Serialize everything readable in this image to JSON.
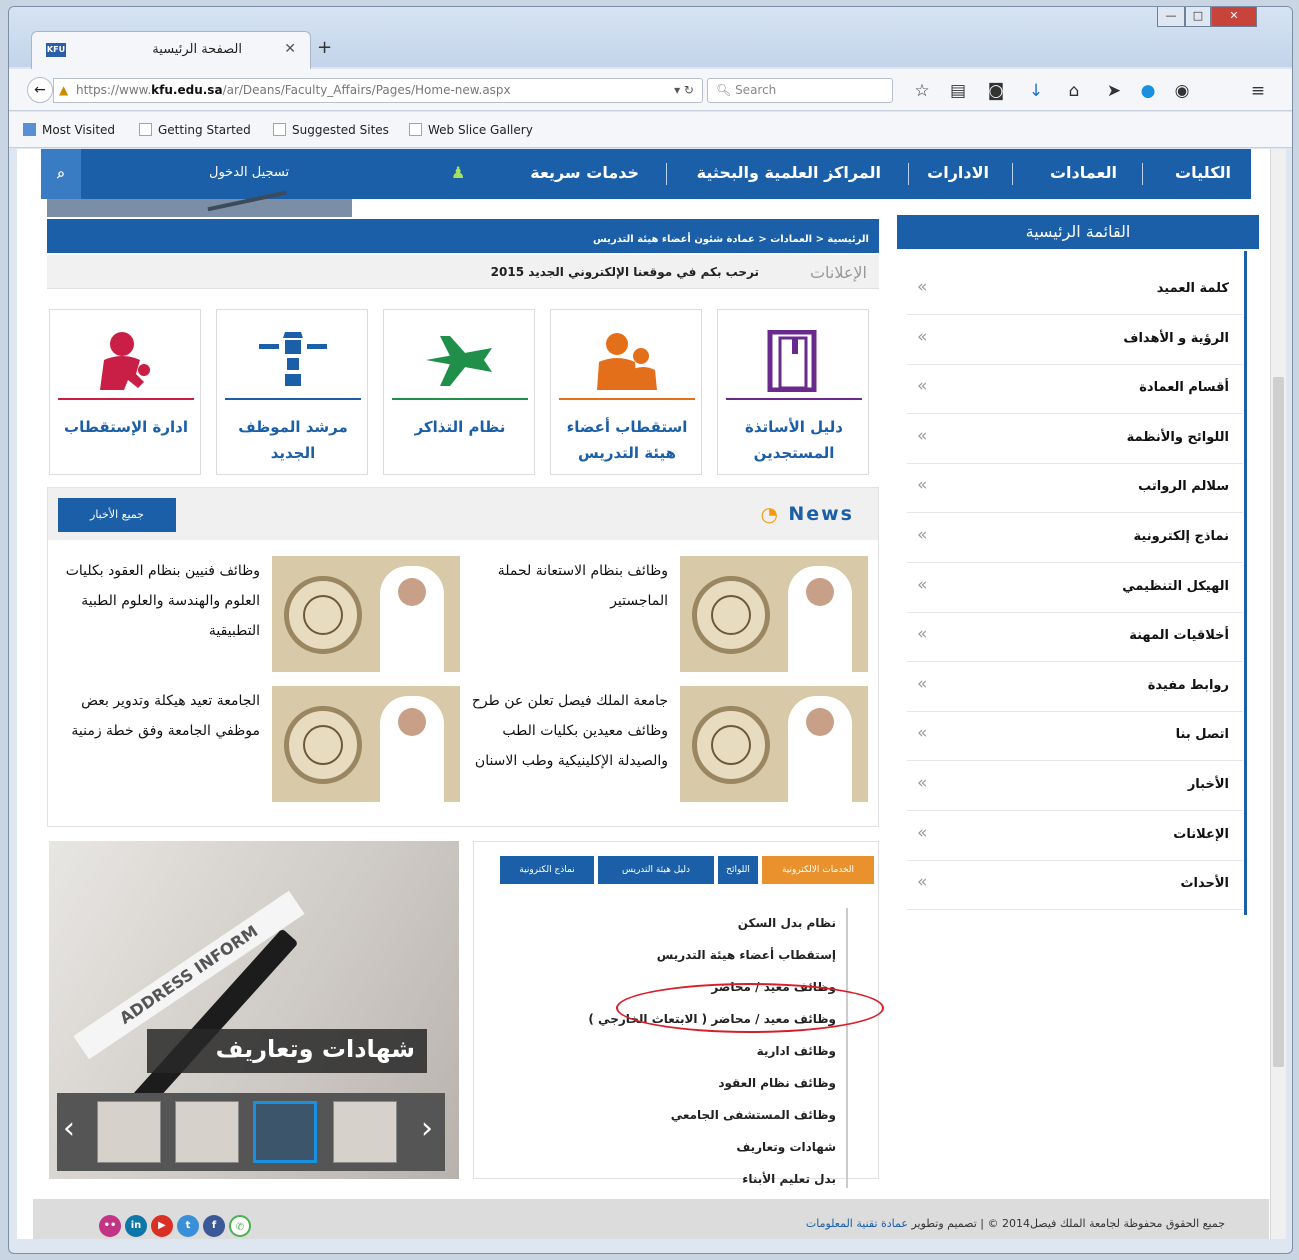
{
  "browser": {
    "tab_title": "الصفحة الرئيسية",
    "tab_favicon": "KFU",
    "url_domain": "kfu.edu.sa",
    "url_prefix": "https://www.",
    "url_path": "/ar/Deans/Faculty_Affairs/Pages/Home-new.aspx",
    "search_placeholder": "Search",
    "bookmarks": [
      "Most Visited",
      "Getting Started",
      "Suggested Sites",
      "Web Slice Gallery"
    ]
  },
  "topnav": {
    "items": [
      "الكليات",
      "العمادات",
      "الادارات",
      "المراكز العلمية والبحثية",
      "خدمات سريعة"
    ],
    "login": "تسجيل الدخول"
  },
  "breadcrumb": "الرئيسية  <  العمادات  <  عمادة شئون أعضاء هيئة التدريس",
  "ticker": {
    "label": "الإعلانات",
    "message": "ترحب بكم في موقعنا الإلكتروني الجديد 2015"
  },
  "tiles": [
    {
      "label": "دليل الأساتذة المستجدين",
      "color": "#6a2a8c",
      "icon": "book-icon"
    },
    {
      "label": "استقطاب أعضاء هيئة التدريس",
      "color": "#e46f1b",
      "icon": "people-icon"
    },
    {
      "label": "نظام التذاكر",
      "color": "#1f8f4a",
      "icon": "plane-icon"
    },
    {
      "label": "مرشد الموظف الجديد",
      "color": "#1b5fa8",
      "icon": "lighthouse-icon"
    },
    {
      "label": "ادارة الإستقطاب",
      "color": "#c91f47",
      "icon": "person-key-icon"
    }
  ],
  "news": {
    "title": "News",
    "all_button": "جميع الأخبار",
    "items": [
      "وظائف بنظام الاستعانة لحملة الماجستير",
      "وظائف فنيين بنظام العقود بكليات العلوم والهندسة والعلوم الطبية التطبيقية",
      "جامعة الملك فيصل تعلن عن طرح وظائف معيدين بكليات الطب والصيدلة الإكلينيكية وطب الاسنان",
      "الجامعة تعيد هيكلة وتدوير بعض موظفي الجامعة وفق خطة زمنية"
    ]
  },
  "promo": {
    "caption": "شهادات وتعاريف",
    "stamp": "ADDRESS INFORM"
  },
  "eservices": {
    "tabs": [
      {
        "label": "الخدمات الالكترونية",
        "color": "#e8912d"
      },
      {
        "label": "اللوائح",
        "color": "#1b5fa8"
      },
      {
        "label": "دليل هيئة التدريس",
        "color": "#1b5fa8"
      },
      {
        "label": "نماذج الكترونية",
        "color": "#1b5fa8"
      }
    ],
    "items": [
      "نظام بدل السكن",
      "إستقطاب أعضاء هيئة التدريس",
      "وظائف معيد / محاضر",
      "وظائف معيد / محاضر ( الابتعاث الخارجي )",
      "وظائف ادارية",
      "وظائف نظام العقود",
      "وظائف المستشفى الجامعي",
      "شهادات وتعاريف",
      "بدل تعليم الأبناء"
    ]
  },
  "side_menu": {
    "title": "القائمة الرئيسية",
    "items": [
      "كلمة العميد",
      "الرؤية و الأهداف",
      "أقسام العمادة",
      "اللوائح والأنظمة",
      "سلالم الرواتب",
      "نماذج إلكترونية",
      "الهيكل التنظيمي",
      "أخلاقيات المهنة",
      "روابط مفيدة",
      "اتصل بنا",
      "الأخبار",
      "الإعلانات",
      "الأحداث"
    ]
  },
  "footer": {
    "copyright": "جميع الحقوق محفوظة لجامعة الملك فيصل2014 © | تصميم وتطوير",
    "credit": "عمادة تقنية المعلومات"
  }
}
